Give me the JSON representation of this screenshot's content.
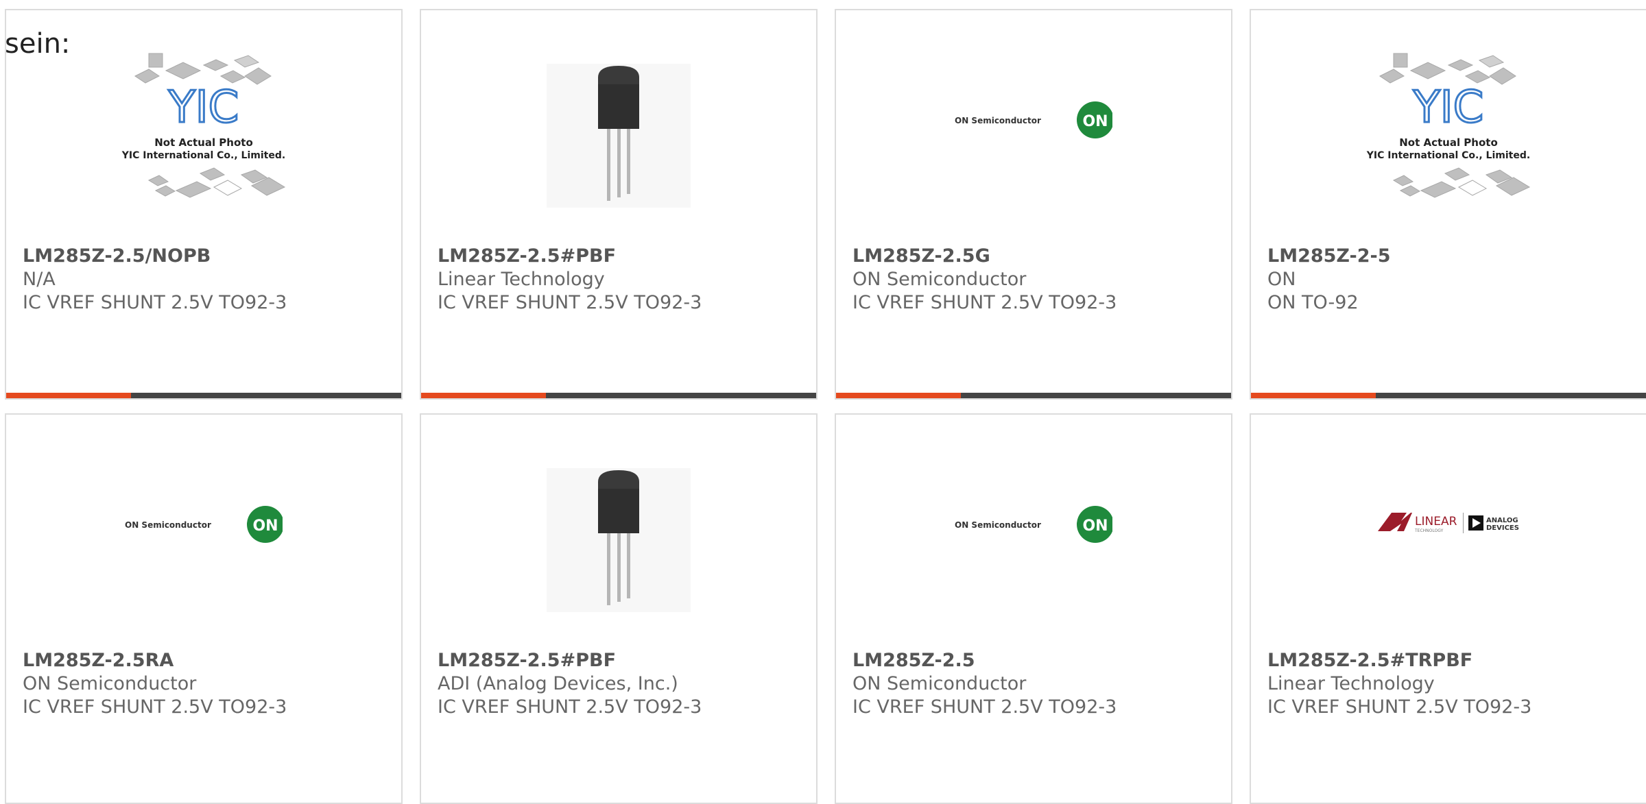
{
  "intro_text": "sein:",
  "colors": {
    "accent": "#e54a1f",
    "bar_dark": "#444444",
    "card_border": "#dcdcdc",
    "on_logo_green": "#1f8a3c",
    "lt_logo_red": "#9b1c2a"
  },
  "image_text": {
    "yic_logo": "YIC",
    "placeholder_line1": "Not Actual Photo",
    "placeholder_line2": "YIC International Co., Limited.",
    "on_brand": "ON Semiconductor",
    "on_circle": "ON",
    "lt_brand": "LINEAR",
    "lt_sub": "TECHNOLOGY",
    "adi_brand_1": "ANALOG",
    "adi_brand_2": "DEVICES"
  },
  "products": [
    {
      "part": "LM285Z-2.5/NOPB",
      "maker": "N/A",
      "desc": "IC VREF SHUNT 2.5V TO92-3",
      "image": "yic-placeholder"
    },
    {
      "part": "LM285Z-2.5#PBF",
      "maker": "Linear Technology",
      "desc": "IC VREF SHUNT 2.5V TO92-3",
      "image": "to92-transistor"
    },
    {
      "part": "LM285Z-2.5G",
      "maker": "ON Semiconductor",
      "desc": "IC VREF SHUNT 2.5V TO92-3",
      "image": "on-semi-logo"
    },
    {
      "part": "LM285Z-2-5",
      "maker": "ON",
      "desc": "ON TO-92",
      "image": "yic-placeholder"
    },
    {
      "part": "LM285Z-2.5RA",
      "maker": "ON Semiconductor",
      "desc": "IC VREF SHUNT 2.5V TO92-3",
      "image": "on-semi-logo"
    },
    {
      "part": "LM285Z-2.5#PBF",
      "maker": "ADI (Analog Devices, Inc.)",
      "desc": "IC VREF SHUNT 2.5V TO92-3",
      "image": "to92-transistor"
    },
    {
      "part": "LM285Z-2.5",
      "maker": "ON Semiconductor",
      "desc": "IC VREF SHUNT 2.5V TO92-3",
      "image": "on-semi-logo"
    },
    {
      "part": "LM285Z-2.5#TRPBF",
      "maker": "Linear Technology",
      "desc": "IC VREF SHUNT 2.5V TO92-3",
      "image": "lt-adi-logo"
    }
  ]
}
